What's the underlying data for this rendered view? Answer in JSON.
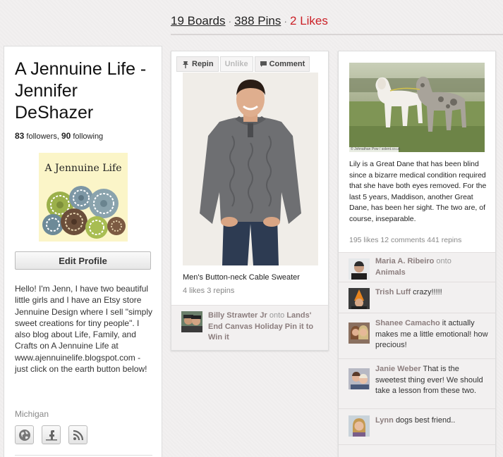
{
  "stats": {
    "boards": "19 Boards",
    "pins": "388 Pins",
    "likes": "2 Likes",
    "sep": "·"
  },
  "profile": {
    "name": "A Jennuine Life - Jennifer DeShazer",
    "followers_count": "83",
    "followers_label": "followers,",
    "following_count": "90",
    "following_label": "following",
    "avatar_title": "A Jennuine Life",
    "edit_label": "Edit Profile",
    "bio": "Hello! I'm Jenn, I have two beautiful little girls and I have an Etsy store Jennuine Design where I sell \"simply sweet creations for tiny people\". I also blog about Life, Family, and Crafts on A Jennuine Life at www.ajennuinelife.blogspot.com - just click on the earth button below!",
    "location": "Michigan",
    "social_icons": [
      "globe-icon",
      "facebook-icon",
      "rss-icon"
    ]
  },
  "pin1": {
    "repin_label": "Repin",
    "unlike_label": "Unlike",
    "comment_label": "Comment",
    "description": "Men's Button-neck Cable Sweater",
    "stats": "4 likes  3 repins",
    "via_user": "Billy Strawter Jr",
    "via_onto": "onto",
    "via_board": "Lands' End Canvas Holiday Pin it to Win it"
  },
  "pin2": {
    "image_credit": "© Johnathan Pow / solent.co.uk",
    "description": "Lily is a Great Dane that has been blind since a bizarre medical condition required that she have both eyes removed. For the last 5 years, Maddison, another Great Dane, has been her sight. The two are, of course, inseparable.",
    "stats": "195 likes  12 comments  441 repins",
    "via_user": "Maria A. Ribeiro",
    "via_onto": "onto",
    "via_board": "Animals",
    "comments": [
      {
        "user": "Trish Luff",
        "text": "crazy!!!!!"
      },
      {
        "user": "Shanee Camacho",
        "text": "it actually makes me a little emotional! how precious!"
      },
      {
        "user": "Janie Weber",
        "text": "That is the sweetest thing ever! We should take a lesson from these two."
      },
      {
        "user": "Lynn",
        "text": "dogs best friend.."
      }
    ]
  },
  "colors": {
    "likes_red": "#cb2027",
    "username_brown": "#8c7e7e",
    "background": "#f2f0f0"
  }
}
